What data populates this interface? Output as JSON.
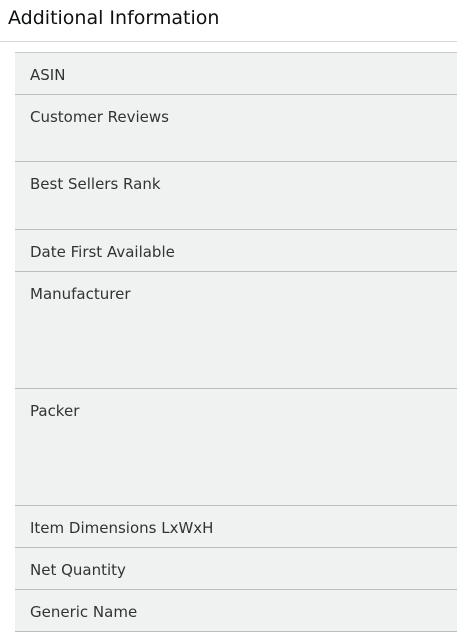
{
  "section": {
    "title": "Additional Information"
  },
  "details": {
    "rows": [
      {
        "label": "ASIN"
      },
      {
        "label": "Customer Reviews"
      },
      {
        "label": "Best Sellers Rank"
      },
      {
        "label": "Date First Available"
      },
      {
        "label": "Manufacturer"
      },
      {
        "label": "Packer"
      },
      {
        "label": "Item Dimensions LxWxH"
      },
      {
        "label": "Net Quantity"
      },
      {
        "label": "Generic Name"
      }
    ]
  },
  "colors": {
    "row_background": "#f0f2f2",
    "row_border": "#bbbfbf",
    "text": "#0f1111"
  }
}
